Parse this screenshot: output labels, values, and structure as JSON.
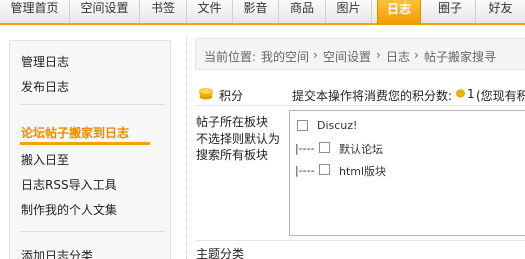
{
  "nav": {
    "tabs": [
      {
        "label": "管理首页"
      },
      {
        "label": "空间设置"
      },
      {
        "label": "书签"
      },
      {
        "label": "文件"
      },
      {
        "label": "影音"
      },
      {
        "label": "商品"
      },
      {
        "label": "图片"
      },
      {
        "label": "日志"
      },
      {
        "label": "圈子"
      },
      {
        "label": "好友"
      }
    ],
    "active_tab": "日志"
  },
  "sidebar": {
    "group1": [
      "管理日志",
      "发布日志"
    ],
    "active_item": "论坛帖子搬家到日志",
    "group2": [
      "搬入日至",
      "日志RSS导入工具",
      "制作我的个人文集"
    ],
    "group3": [
      "添加日志分类"
    ]
  },
  "breadcrumb": {
    "prefix": "当前位置:",
    "items": [
      "我的空间",
      "空间设置",
      "日志",
      "帖子搬家搜寻"
    ],
    "separator": "›"
  },
  "points": {
    "label": "积分",
    "notice": "提交本操作将消费您的积分数:",
    "cost": "1",
    "suffix": "(您现有积",
    "coin_icon": "coin-icon",
    "coin_color": "#f2b200"
  },
  "board": {
    "label_title": "帖子所在板块",
    "label_hint_line1": "不选择则默认为",
    "label_hint_line2": "搜索所有板块",
    "options": [
      {
        "prefix": "",
        "name": "Discuz!",
        "checked": false
      },
      {
        "prefix": "|----",
        "name": "默认论坛",
        "checked": false
      },
      {
        "prefix": "|----",
        "name": "html版块",
        "checked": false
      }
    ]
  },
  "topic": {
    "label": "主题分类"
  },
  "colors": {
    "accent": "#f6a00a",
    "active_text": "#f08a00"
  }
}
